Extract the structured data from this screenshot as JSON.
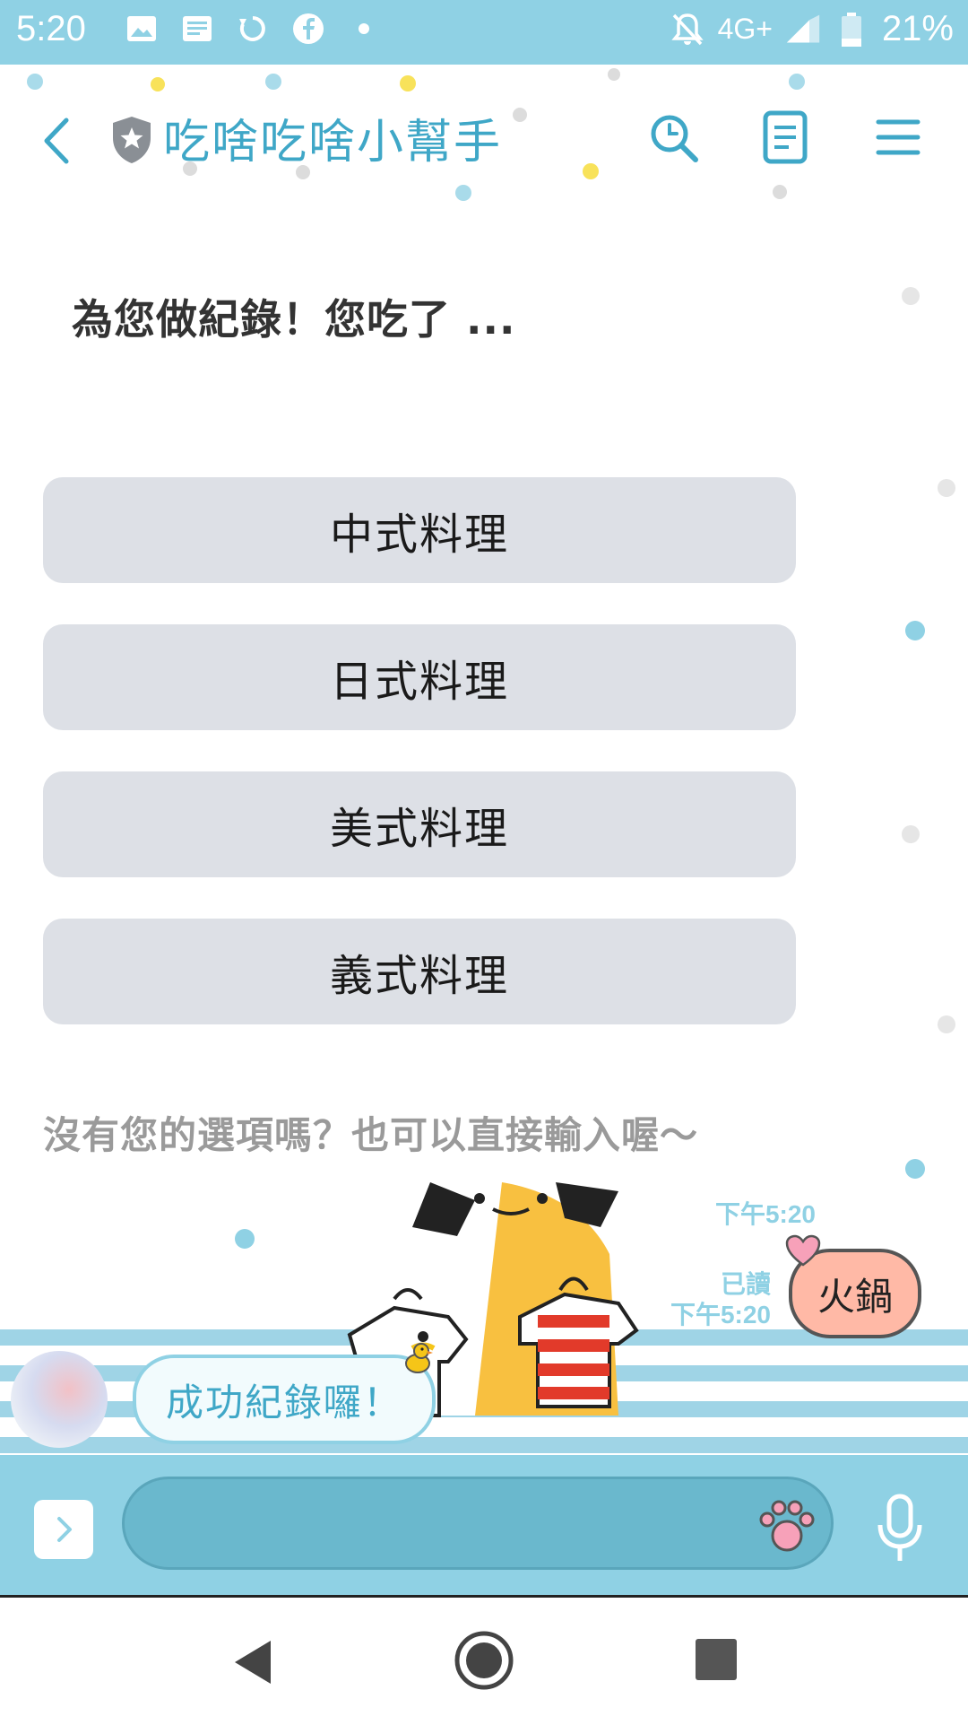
{
  "status_bar": {
    "time": "5:20",
    "network": "4G+",
    "battery": "21%",
    "icons": [
      "image-icon",
      "news-icon",
      "sync-icon",
      "facebook-icon",
      "notification-dot-icon",
      "mute-icon",
      "signal-icon",
      "battery-icon"
    ]
  },
  "header": {
    "title": "吃啥吃啥小幫手",
    "icons": [
      "back-icon",
      "shield-icon",
      "search-icon",
      "notes-icon",
      "menu-icon"
    ]
  },
  "chat": {
    "prompt": "為您做紀錄！您吃了 ...",
    "options": [
      "中式料理",
      "日式料理",
      "美式料理",
      "義式料理"
    ],
    "hint": "沒有您的選項嗎？也可以直接輸入喔～",
    "messages": [
      {
        "sender": "user",
        "type": "sticker",
        "time": "下午5:20"
      },
      {
        "sender": "user",
        "type": "text",
        "text": "火鍋",
        "read": "已讀",
        "time": "下午5:20"
      },
      {
        "sender": "bot",
        "type": "text",
        "text": "成功紀錄囉！"
      }
    ]
  },
  "input": {
    "placeholder": "",
    "icons": [
      "chevron-right-icon",
      "paw-icon",
      "mic-icon"
    ]
  },
  "colors": {
    "accent": "#8fd1e4",
    "title": "#3fa7c7",
    "option_bg": "#dde0e6",
    "user_bubble": "#ffb9a6"
  }
}
